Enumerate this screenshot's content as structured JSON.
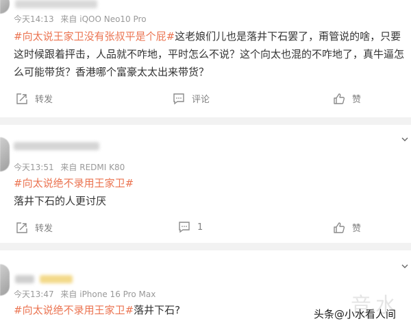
{
  "comments": [
    {
      "meta": {
        "time": "今天14:13",
        "source": "来自 iQOO Neo10 Pro"
      },
      "tag": "#向太说王家卫没有张叔平是个屁#",
      "text": "这老娘们儿也是落井下石罢了，甭管说的啥，只要这时候跟着抨击，人品就不咋地，平时怎么不说？这个向太也混的不咋地了，真牛逼怎么可能带货？香港哪个富豪太太出来带货？",
      "actions": {
        "repost": "转发",
        "comment": "评论",
        "like": "赞"
      }
    },
    {
      "meta": {
        "time": "今天13:51",
        "source": "来自 REDMI K80"
      },
      "tag": "#向太说绝不录用王家卫#",
      "text": "落井下石的人更讨厌",
      "actions": {
        "repost": "转发",
        "comment": "1",
        "like": "赞"
      }
    },
    {
      "meta": {
        "time": "今天13:47",
        "source": "来自 iPhone 16 Pro Max"
      },
      "tag": "#向太说绝不录用王家卫#",
      "text": "落井下石?"
    }
  ],
  "watermark": {
    "caption": "头条@小水看人间",
    "faint": "音水"
  },
  "colors": {
    "tag": "#eb7350",
    "meta": "#999999",
    "text": "#333333",
    "background": "#f2f2f2"
  },
  "icons": [
    "repost-icon",
    "comment-icon",
    "like-icon",
    "chevron-down-icon"
  ]
}
